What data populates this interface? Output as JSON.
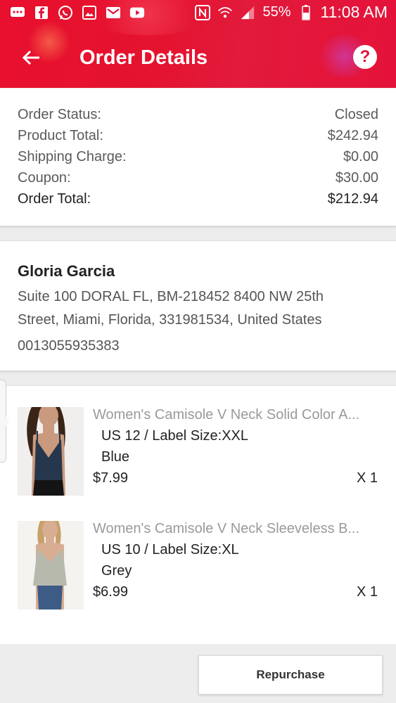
{
  "statusbar": {
    "battery": "55%",
    "time": "11:08 AM"
  },
  "header": {
    "title": "Order Details"
  },
  "summary": {
    "rows": [
      {
        "label": "Order Status:",
        "value": "Closed"
      },
      {
        "label": "Product Total:",
        "value": "$242.94"
      },
      {
        "label": "Shipping Charge:",
        "value": "$0.00"
      },
      {
        "label": "Coupon:",
        "value": "$30.00"
      },
      {
        "label": "Order Total:",
        "value": "$212.94"
      }
    ]
  },
  "address": {
    "name": "Gloria Garcia",
    "line1": "Suite 100 DORAL FL, BM-218452 8400 NW 25th",
    "line2": "Street, Miami, Florida, 331981534, United States",
    "phone": "0013055935383"
  },
  "items": [
    {
      "name": "Women's Camisole V Neck Solid Color A...",
      "size": "US 12 / Label Size:XXL",
      "color": "Blue",
      "price": "$7.99",
      "qty": "X 1"
    },
    {
      "name": "Women's Camisole V Neck Sleeveless B...",
      "size": "US 10 / Label Size:XL",
      "color": "Grey",
      "price": "$6.99",
      "qty": "X 1"
    }
  ],
  "actions": {
    "repurchase_label": "Repurchase"
  },
  "colors": {
    "brand": "#e4123a"
  }
}
